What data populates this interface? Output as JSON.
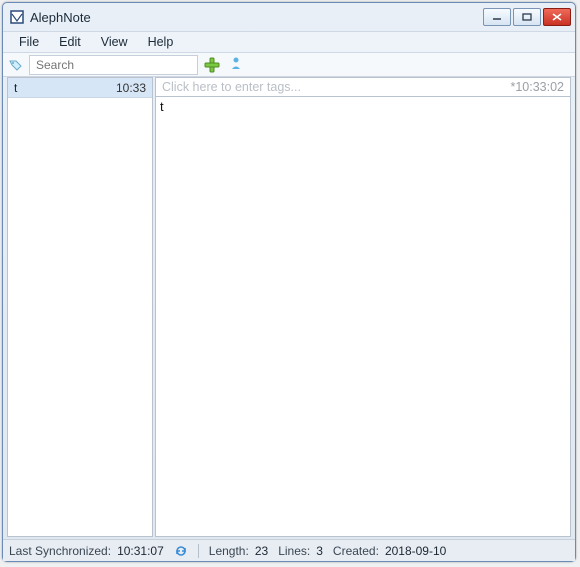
{
  "window": {
    "title": "AlephNote"
  },
  "menubar": {
    "items": [
      "File",
      "Edit",
      "View",
      "Help"
    ]
  },
  "toolbar": {
    "search_placeholder": "Search",
    "note_title": ""
  },
  "sidebar": {
    "notes": [
      {
        "name": "t",
        "time": "10:33"
      }
    ]
  },
  "editor": {
    "tags_placeholder": "Click here to enter tags...",
    "timestamp": "*10:33:02",
    "content": "t"
  },
  "statusbar": {
    "last_sync_label": "Last Synchronized:",
    "last_sync_value": "10:31:07",
    "length_label": "Length:",
    "length_value": "23",
    "lines_label": "Lines:",
    "lines_value": "3",
    "created_label": "Created:",
    "created_value": "2018-09-10"
  }
}
